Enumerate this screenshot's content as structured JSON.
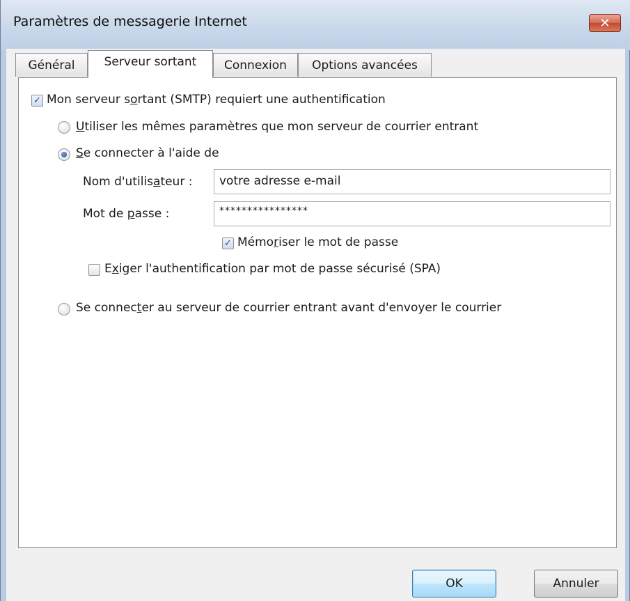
{
  "window": {
    "title": "Paramètres de messagerie Internet",
    "close_icon": "close-icon",
    "close_symbol": "✕"
  },
  "tabs": [
    {
      "label": "Général",
      "active": false
    },
    {
      "label": "Serveur sortant",
      "active": true
    },
    {
      "label": "Connexion",
      "active": false
    },
    {
      "label": "Options avancées",
      "active": false
    }
  ],
  "smtp_auth": {
    "checked": true,
    "label_a": "Mon serveur s",
    "label_key": "o",
    "label_b": "rtant (SMTP) requiert une authentification"
  },
  "radio_same": {
    "selected": false,
    "label_key": "U",
    "label_rest": "tiliser les mêmes paramètres que mon serveur de courrier entrant"
  },
  "radio_login": {
    "selected": true,
    "label_key": "S",
    "label_rest": "e connecter à l'aide de"
  },
  "username": {
    "label_a": "Nom d'utilis",
    "label_key": "a",
    "label_b": "teur :",
    "value": "votre adresse e-mail"
  },
  "password": {
    "label_a": "Mot de ",
    "label_key": "p",
    "label_b": "asse :",
    "value": "****************"
  },
  "remember": {
    "checked": true,
    "label_a": "Mémo",
    "label_key": "r",
    "label_b": "iser le mot de passe"
  },
  "spa": {
    "checked": false,
    "label_a": "E",
    "label_key": "x",
    "label_b": "iger l'authentification par mot de passe sécurisé (SPA)"
  },
  "radio_before": {
    "selected": false,
    "label_a": "Se connec",
    "label_key": "t",
    "label_b": "er au serveur de courrier entrant avant d'envoyer le courrier"
  },
  "buttons": {
    "ok": "OK",
    "cancel": "Annuler"
  },
  "check_glyph": "✓"
}
